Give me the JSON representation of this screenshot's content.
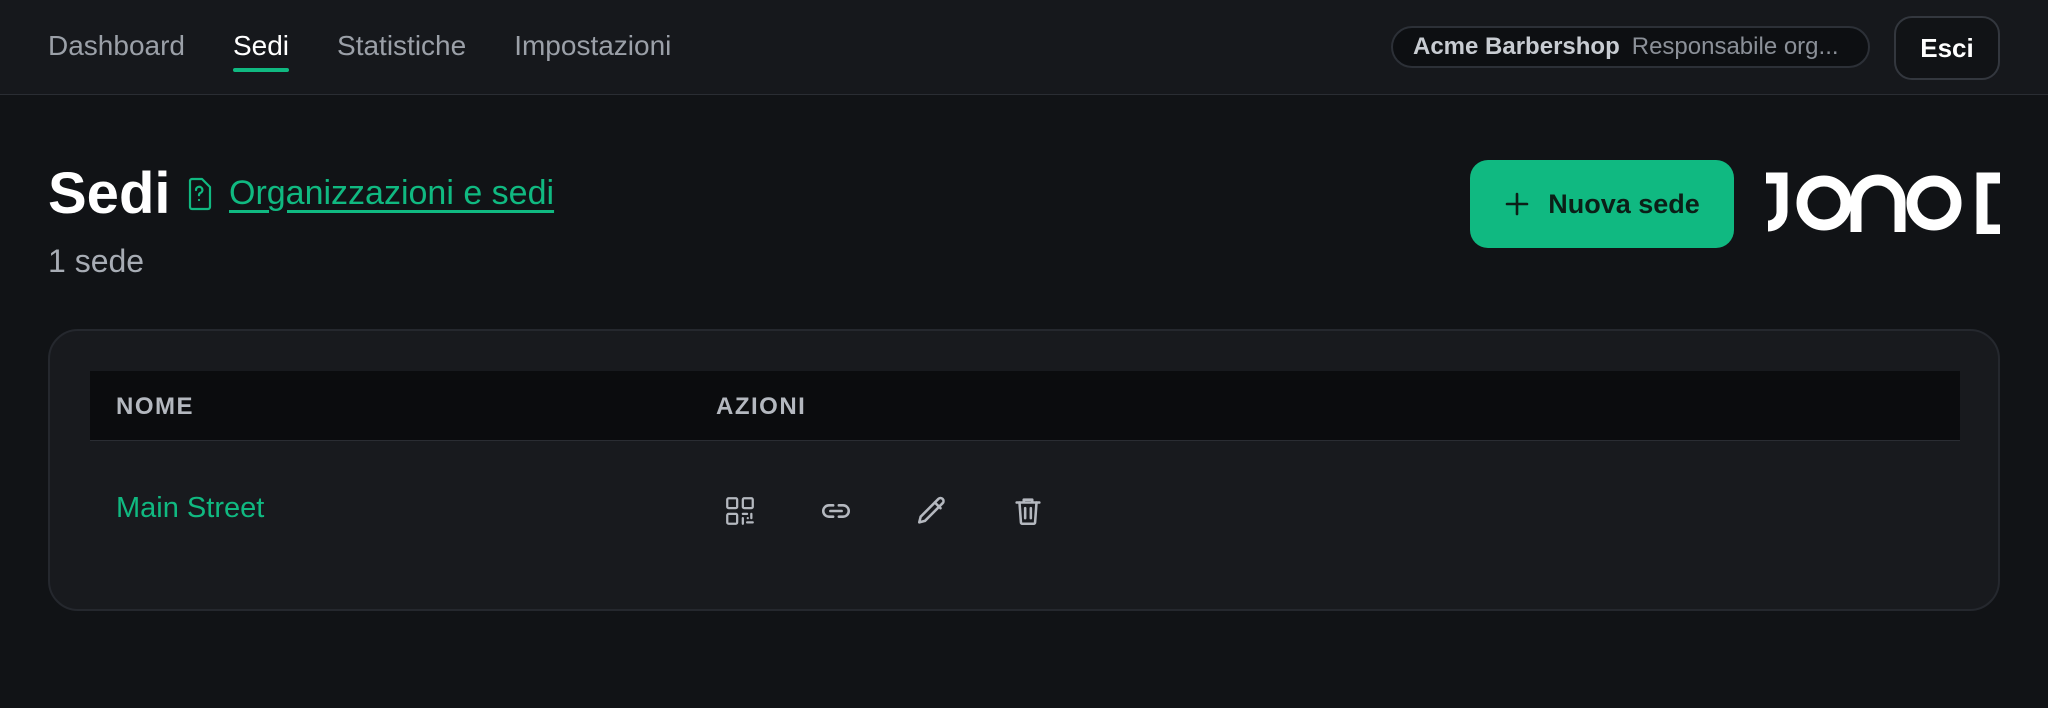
{
  "nav": {
    "items": [
      {
        "label": "Dashboard",
        "active": false
      },
      {
        "label": "Sedi",
        "active": true
      },
      {
        "label": "Statistiche",
        "active": false
      },
      {
        "label": "Impostazioni",
        "active": false
      }
    ]
  },
  "account": {
    "org_name": "Acme Barbershop",
    "role": "Responsabile org...",
    "logout_label": "Esci"
  },
  "page": {
    "title": "Sedi",
    "help_link": "Organizzazioni e sedi",
    "subtitle": "1 sede",
    "new_button_label": "Nuova sede"
  },
  "table": {
    "columns": [
      "NOME",
      "AZIONI"
    ],
    "rows": [
      {
        "name": "Main Street",
        "actions": [
          "qr-code-icon",
          "link-icon",
          "edit-icon",
          "delete-icon"
        ]
      }
    ]
  },
  "colors": {
    "accent": "#10b981",
    "background": "#111316",
    "card": "#181a1e"
  }
}
